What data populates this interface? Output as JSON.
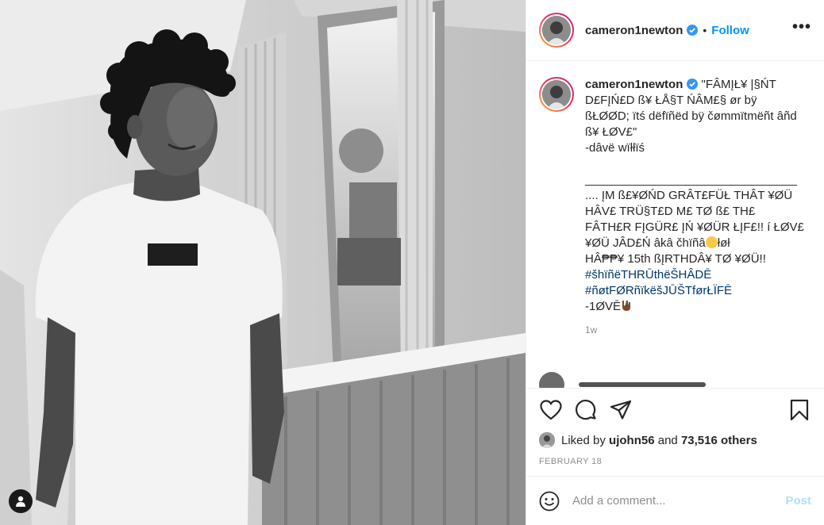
{
  "post": {
    "username": "cameron1newton",
    "follow_label": "Follow",
    "separator": "•",
    "more_label": "•••",
    "caption": {
      "username": "cameron1newton",
      "line1": " \"FÂMĮŁ¥ |§ŃT",
      "line2": "D£FĮŃ£D ß¥ ŁÅ§T ŃÂM£§ ør bÿ",
      "line3": "ßŁØØD; ïtś dëfïñëd bÿ čømmïtmëñt âñd",
      "line4": "ß¥ ŁØV£\"",
      "line5": "-dâvë wïłłïś",
      "divider": "________________________________",
      "line6": ".... ĮM ß£¥ØŃD GRÂT£FÜŁ THÂT ¥ØÜ",
      "line7": "HÂV£ TRÜ§T£D M£ TØ ß£ TH£",
      "line8": "FÂTH£R FĮGÜR£ ĮŃ ¥ØÜR ŁĮF£!! í ŁØV£",
      "line9": "¥ØÜ JÂD£Ń âkâ čhïñâ",
      "line9_end": "łøł",
      "line10": "HÂ₱₱¥ 15th ßĮRTHDÂ¥ TØ ¥ØÜ!!",
      "hashtag1": "#šhïñëTHRŪthëŠHÂDĒ",
      "hashtag2": "#ñøtFØRñïkëšJŪŠTførŁÏFĒ",
      "signoff": "-1ØVĒ"
    },
    "time_ago": "1w",
    "likes": {
      "prefix": "Liked by",
      "user": "ujohn56",
      "joiner": "and",
      "others": "73,516 others"
    },
    "date": "FEBRUARY 18",
    "add_comment_placeholder": "Add a comment...",
    "post_label": "Post"
  },
  "icons": {
    "like": "heart-icon",
    "comment": "comment-icon",
    "share": "paper-plane-icon",
    "save": "bookmark-icon",
    "emoji": "smiley-icon",
    "tag": "person-tag-icon",
    "verified": "verified-badge-icon"
  },
  "colors": {
    "link_blue": "#0095f6",
    "hashtag_blue": "#00376b",
    "muted_gray": "#8e8e8e",
    "post_disabled": "#b2dffc"
  }
}
